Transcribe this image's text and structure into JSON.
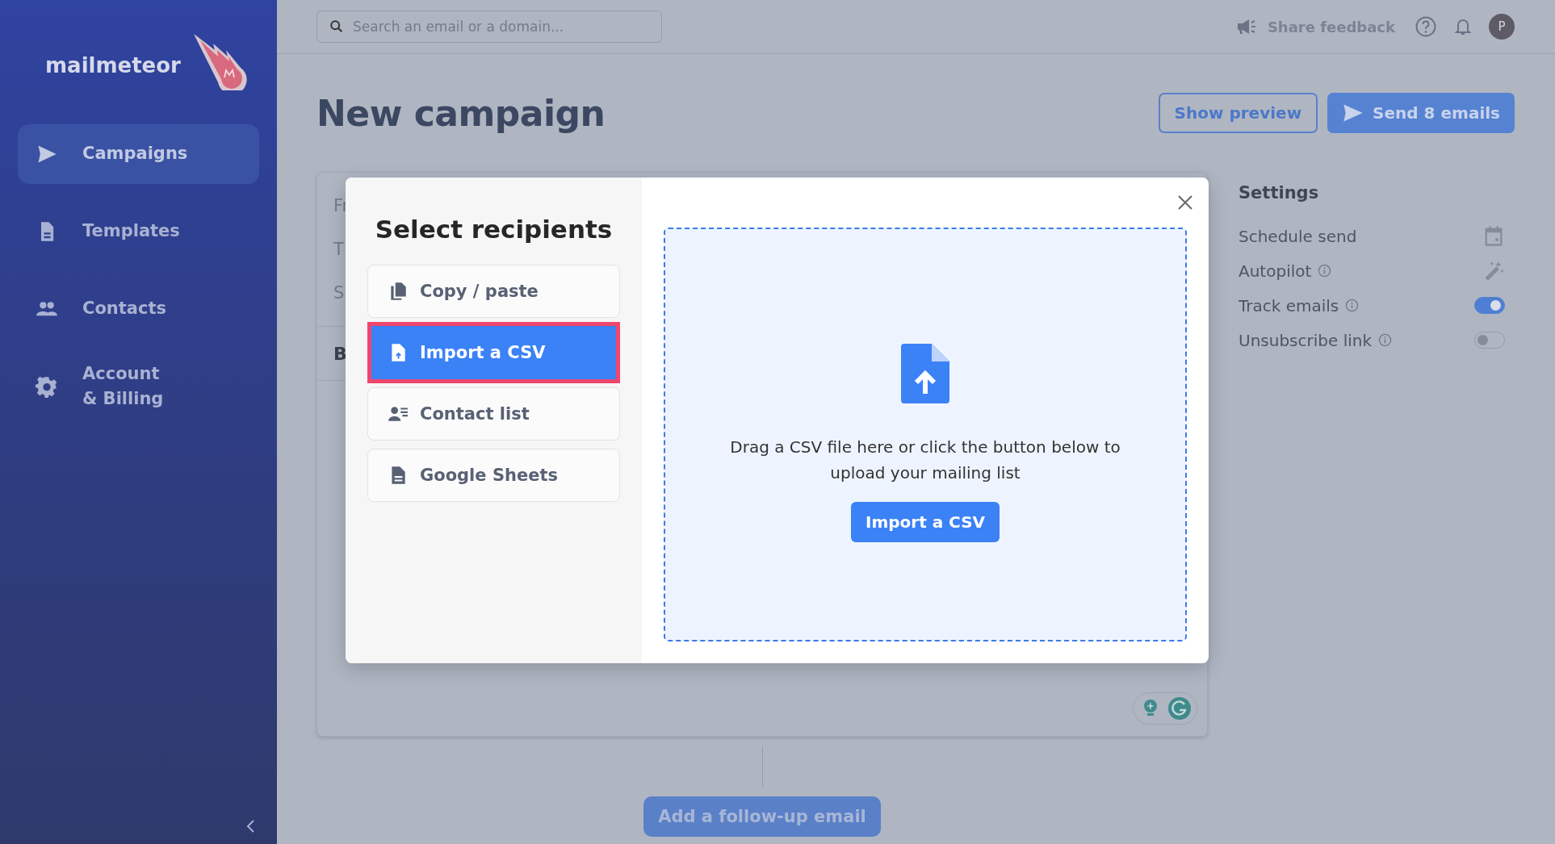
{
  "sidebar": {
    "logo": "mailmeteor",
    "items": [
      {
        "label": "Campaigns",
        "selected": true
      },
      {
        "label": "Templates",
        "selected": false
      },
      {
        "label": "Contacts",
        "selected": false
      },
      {
        "label": "Account & Billing",
        "selected": false
      }
    ]
  },
  "search": {
    "placeholder": "Search an email or a domain..."
  },
  "topbar": {
    "feedback": "Share feedback",
    "avatar": "P"
  },
  "page": {
    "title": "New campaign",
    "buttons": [
      {
        "label": "Show preview",
        "kind": "outline"
      },
      {
        "label": "Send 8 emails",
        "kind": "primary"
      }
    ]
  },
  "editor": {
    "field_labels": [
      "Fr",
      "T",
      "S"
    ],
    "body_label": "B"
  },
  "settings": {
    "title": "Settings",
    "rows": [
      {
        "label": "Schedule send",
        "info": false,
        "kind": "calendar"
      },
      {
        "label": "Autopilot",
        "info": true,
        "kind": "wand"
      },
      {
        "label": "Track emails",
        "info": true,
        "kind": "toggle",
        "on": true
      },
      {
        "label": "Unsubscribe link",
        "info": true,
        "kind": "toggle",
        "on": false
      }
    ]
  },
  "modal": {
    "title": "Select recipients",
    "options": [
      {
        "label": "Copy / paste",
        "selected": false
      },
      {
        "label": "Import a CSV",
        "selected": true
      },
      {
        "label": "Contact list",
        "selected": false
      },
      {
        "label": "Google Sheets",
        "selected": false
      }
    ],
    "dropzone": {
      "text": "Drag a CSV file here or click the button below to upload your mailing list",
      "button": "Import a CSV"
    }
  },
  "follow_up": {
    "label": "Add a follow-up email"
  }
}
